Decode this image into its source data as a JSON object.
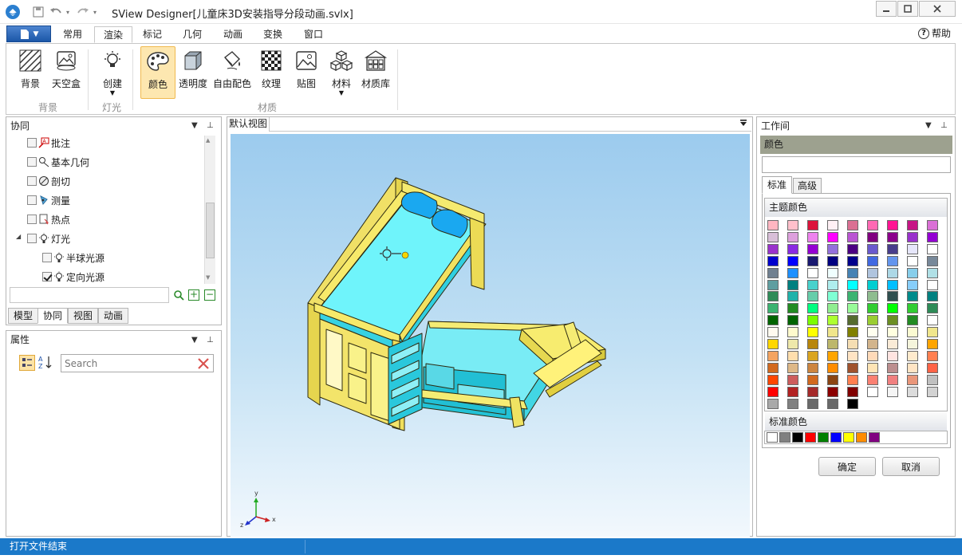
{
  "app": {
    "title": "SView Designer[儿童床3D安装指导分段动画.svlx]"
  },
  "ribbon_tabs": [
    "常用",
    "渲染",
    "标记",
    "几何",
    "动画",
    "变换",
    "窗口"
  ],
  "active_tab": "渲染",
  "help_label": "帮助",
  "ribbon": {
    "buttons": [
      {
        "label": "背景",
        "icon": "background-icon"
      },
      {
        "label": "天空盒",
        "icon": "skybox-icon"
      },
      {
        "label": "创建",
        "icon": "light-bulb-icon"
      },
      {
        "label": "颜色",
        "icon": "palette-icon"
      },
      {
        "label": "透明度",
        "icon": "cube-icon"
      },
      {
        "label": "自由配色",
        "icon": "paint-bucket-icon"
      },
      {
        "label": "纹理",
        "icon": "checker-icon"
      },
      {
        "label": "贴图",
        "icon": "image-icon"
      },
      {
        "label": "材料",
        "icon": "cubes-icon"
      },
      {
        "label": "材质库",
        "icon": "library-icon"
      }
    ],
    "groups": [
      "背景",
      "灯光",
      "材质"
    ]
  },
  "collab_panel": {
    "title": "协同",
    "items": [
      {
        "label": "批注",
        "checked": false
      },
      {
        "label": "基本几何",
        "checked": false
      },
      {
        "label": "剖切",
        "checked": false
      },
      {
        "label": "测量",
        "checked": false
      },
      {
        "label": "热点",
        "checked": false
      },
      {
        "label": "灯光",
        "checked": false
      },
      {
        "label": "半球光源",
        "checked": false
      },
      {
        "label": "定向光源",
        "checked": true
      }
    ],
    "bottom_tabs": [
      "模型",
      "协同",
      "视图",
      "动画"
    ],
    "active_bottom_tab": "协同"
  },
  "properties_panel": {
    "title": "属性",
    "search_placeholder": "Search"
  },
  "viewport": {
    "tab_label": "默认视图",
    "axes": {
      "x": "x",
      "y": "y",
      "z": "z"
    }
  },
  "workspace": {
    "title": "工作间",
    "color_header": "颜色",
    "tabs": [
      "标准",
      "高级"
    ],
    "active_tab": "标准",
    "theme_colors_label": "主题颜色",
    "standard_colors_label": "标准颜色",
    "ok_label": "确定",
    "cancel_label": "取消",
    "theme_columns": [
      [
        "#ffb6c1",
        "#d8bfd8",
        "#9932cc",
        "#0000cd",
        "#708090",
        "#5f9ea0",
        "#2e8b57",
        "#3cb371",
        "#006400",
        "#fffaf0",
        "#ffd700",
        "#f4a460",
        "#d2691e",
        "#ff4500",
        "#ff0000",
        "#a9a9a9"
      ],
      [
        "#ffc0cb",
        "#dda0dd",
        "#8a2be2",
        "#0000ff",
        "#1e90ff",
        "#008080",
        "#20b2aa",
        "#228b22",
        "#006400",
        "#fffacd",
        "#eee8aa",
        "#ffdead",
        "#deb887",
        "#cd5c5c",
        "#b22222",
        "#808080"
      ],
      [
        "#dc143c",
        "#ee82ee",
        "#9400d3",
        "#191970",
        "#ffffff",
        "#48d1cc",
        "#66cdaa",
        "#00ff7f",
        "#7cfc00",
        "#ffff00",
        "#b8860b",
        "#daa520",
        "#cd853f",
        "#d2691e",
        "#a52a2a",
        "#696969"
      ],
      [
        "#fff0f5",
        "#ff00ff",
        "#9370db",
        "#000080",
        "#f0ffff",
        "#afeeee",
        "#7fffd4",
        "#90ee90",
        "#adff2f",
        "#f0e68c",
        "#bdb76b",
        "#ffa500",
        "#ff8c00",
        "#8b4513",
        "#8b0000",
        "#696969"
      ],
      [
        "#db7093",
        "#ba55d3",
        "#4b0082",
        "#00008b",
        "#4682b4",
        "#00ffff",
        "#3cb371",
        "#98fb98",
        "#556b2f",
        "#808000",
        "#f5deb3",
        "#ffe4c4",
        "#a0522d",
        "#ff7f50",
        "#800000",
        "#000000"
      ],
      [
        "#ff69b4",
        "#800080",
        "#6a5acd",
        "#4169e1",
        "#b0c4de",
        "#00ced1",
        "#8fbc8f",
        "#32cd32",
        "#9acd32",
        "#fffff0",
        "#d2b48c",
        "#ffdab9",
        "#ffe4b5",
        "#fa8072",
        "#ffffff"
      ],
      [
        "#ff1493",
        "#8b008b",
        "#483d8b",
        "#6495ed",
        "#add8e6",
        "#00bfff",
        "#2f4f4f",
        "#00ff00",
        "#6b8e23",
        "#ffffe0",
        "#faebd7",
        "#ffe4e1",
        "#bc8f8f",
        "#f08080",
        "#f5f5f5"
      ],
      [
        "#c71585",
        "#9932cc",
        "#e6e6fa",
        "#ffffff",
        "#87ceeb",
        "#87cefa",
        "#008b8b",
        "#32cd32",
        "#228b22",
        "#fafad2",
        "#f5f5dc",
        "#ffebcd",
        "#ffe4c4",
        "#e9967a",
        "#dcdcdc"
      ],
      [
        "#da70d6",
        "#9400d3",
        "#ffffff",
        "#778899",
        "#b0e0e6",
        "#ffffff",
        "#008080",
        "#2e8b57",
        "#ffffff",
        "#f0e68c",
        "#ffa500",
        "#ff7f50",
        "#ff6347",
        "#c0c0c0",
        "#d3d3d3"
      ]
    ],
    "standard_row": [
      "#ffffff",
      "#808080",
      "#000000",
      "#ff0000",
      "#008000",
      "#0000ff",
      "#ffff00",
      "#ff8c00",
      "#800080"
    ]
  },
  "status": {
    "text": "打开文件结束"
  }
}
